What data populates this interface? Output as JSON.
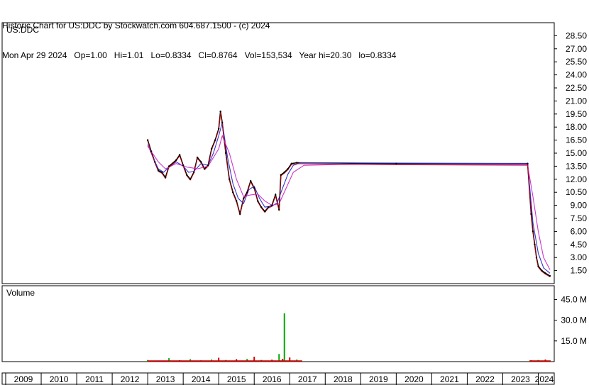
{
  "header": {
    "line1": "Historic Chart for US:DDC by Stockwatch.com 604.687.1500 - (c) 2024",
    "line2": "Mon Apr 29 2024   Op=1.00   Hi=1.01   Lo=0.8334   Cl=0.8764   Vol=153,534   Year hi=20.30   lo=0.8334"
  },
  "colors": {
    "price": "#000000",
    "ma_short": "#cc0000",
    "ma_long": "#3333cc",
    "ma_link": "#cc33cc",
    "volume_up": "#00aa00",
    "volume_down": "#cc0000",
    "grid": "#000000",
    "frame": "#000000"
  },
  "chart_data": [
    {
      "type": "line",
      "panel": "price",
      "title": "US:DDC",
      "ylim": [
        0,
        30
      ],
      "y_ticks": [
        "28.50",
        "27.00",
        "25.50",
        "24.00",
        "22.50",
        "21.00",
        "19.50",
        "18.00",
        "16.50",
        "15.00",
        "13.50",
        "12.00",
        "10.50",
        "9.00",
        "7.50",
        "6.00",
        "4.50",
        "3.00",
        "1.50"
      ],
      "x_ticks": [
        "2009",
        "2010",
        "2011",
        "2012",
        "2013",
        "2014",
        "2015",
        "2016",
        "2017",
        "2018",
        "2019",
        "2020",
        "2021",
        "2022",
        "2023",
        "2024"
      ],
      "series": [
        {
          "values": [
            [
              2013.0,
              16.5
            ],
            [
              2013.1,
              15.2
            ],
            [
              2013.2,
              14.0
            ],
            [
              2013.3,
              13.0
            ],
            [
              2013.4,
              12.8
            ],
            [
              2013.5,
              12.2
            ],
            [
              2013.6,
              13.5
            ],
            [
              2013.8,
              14.2
            ],
            [
              2013.9,
              14.8
            ],
            [
              2014.0,
              13.6
            ],
            [
              2014.1,
              12.5
            ],
            [
              2014.2,
              12.0
            ],
            [
              2014.3,
              12.8
            ],
            [
              2014.4,
              14.5
            ],
            [
              2014.5,
              14.0
            ],
            [
              2014.6,
              13.2
            ],
            [
              2014.7,
              13.6
            ],
            [
              2014.8,
              15.5
            ],
            [
              2014.9,
              16.5
            ],
            [
              2015.0,
              17.8
            ],
            [
              2015.05,
              19.8
            ],
            [
              2015.1,
              18.5
            ],
            [
              2015.2,
              15.0
            ],
            [
              2015.3,
              12.0
            ],
            [
              2015.4,
              10.5
            ],
            [
              2015.5,
              9.5
            ],
            [
              2015.6,
              8.0
            ],
            [
              2015.7,
              9.8
            ],
            [
              2015.8,
              10.5
            ],
            [
              2015.9,
              11.8
            ],
            [
              2016.0,
              11.0
            ],
            [
              2016.1,
              9.5
            ],
            [
              2016.2,
              8.8
            ],
            [
              2016.3,
              8.3
            ],
            [
              2016.4,
              8.8
            ],
            [
              2016.5,
              9.0
            ],
            [
              2016.6,
              10.2
            ],
            [
              2016.7,
              8.5
            ],
            [
              2016.75,
              12.5
            ],
            [
              2016.85,
              12.8
            ],
            [
              2016.95,
              13.2
            ],
            [
              2017.05,
              13.8
            ],
            [
              2017.2,
              13.9
            ],
            [
              2020.0,
              13.8
            ],
            [
              2023.7,
              13.8
            ],
            [
              2023.8,
              8.0
            ],
            [
              2023.85,
              6.0
            ],
            [
              2023.9,
              4.5
            ],
            [
              2023.95,
              3.0
            ],
            [
              2024.0,
              2.0
            ],
            [
              2024.1,
              1.5
            ],
            [
              2024.2,
              1.2
            ],
            [
              2024.33,
              0.88
            ]
          ]
        },
        {
          "values": [
            [
              2013.0,
              16.0
            ],
            [
              2013.15,
              14.5
            ],
            [
              2013.3,
              13.2
            ],
            [
              2013.45,
              12.8
            ],
            [
              2013.6,
              13.4
            ],
            [
              2013.8,
              14.0
            ],
            [
              2014.0,
              13.5
            ],
            [
              2014.15,
              12.8
            ],
            [
              2014.3,
              12.9
            ],
            [
              2014.5,
              13.8
            ],
            [
              2014.7,
              13.6
            ],
            [
              2014.85,
              15.0
            ],
            [
              2015.0,
              17.0
            ],
            [
              2015.1,
              18.5
            ],
            [
              2015.25,
              14.5
            ],
            [
              2015.4,
              11.5
            ],
            [
              2015.55,
              9.8
            ],
            [
              2015.7,
              9.2
            ],
            [
              2015.85,
              10.8
            ],
            [
              2016.0,
              11.2
            ],
            [
              2016.15,
              9.8
            ],
            [
              2016.3,
              8.8
            ],
            [
              2016.5,
              8.9
            ],
            [
              2016.65,
              9.3
            ],
            [
              2016.8,
              11.0
            ],
            [
              2016.95,
              12.6
            ],
            [
              2017.1,
              13.6
            ],
            [
              2017.3,
              13.9
            ],
            [
              2023.7,
              13.8
            ],
            [
              2023.85,
              7.0
            ],
            [
              2024.0,
              3.5
            ],
            [
              2024.15,
              1.8
            ],
            [
              2024.33,
              1.2
            ]
          ]
        },
        {
          "values": [
            [
              2013.0,
              15.8
            ],
            [
              2013.3,
              14.0
            ],
            [
              2013.5,
              13.2
            ],
            [
              2013.8,
              13.8
            ],
            [
              2014.1,
              13.4
            ],
            [
              2014.4,
              13.2
            ],
            [
              2014.7,
              13.5
            ],
            [
              2015.0,
              15.5
            ],
            [
              2015.1,
              17.0
            ],
            [
              2015.3,
              15.0
            ],
            [
              2015.5,
              12.0
            ],
            [
              2015.7,
              10.0
            ],
            [
              2015.9,
              10.2
            ],
            [
              2016.1,
              10.3
            ],
            [
              2016.3,
              9.5
            ],
            [
              2016.5,
              9.0
            ],
            [
              2016.7,
              9.2
            ],
            [
              2016.9,
              11.0
            ],
            [
              2017.1,
              12.8
            ],
            [
              2017.4,
              13.6
            ],
            [
              2018.5,
              13.7
            ],
            [
              2023.7,
              13.6
            ],
            [
              2023.85,
              10.0
            ],
            [
              2024.0,
              6.0
            ],
            [
              2024.15,
              3.0
            ],
            [
              2024.33,
              1.6
            ]
          ]
        }
      ]
    },
    {
      "type": "bar",
      "panel": "volume",
      "title": "Volume",
      "ylim": [
        0,
        55
      ],
      "y_ticks": [
        "45.0 M",
        "30.0 M",
        "15.0 M"
      ],
      "values": [
        [
          2013.0,
          1.2
        ],
        [
          2013.3,
          0.8
        ],
        [
          2013.6,
          2.5
        ],
        [
          2013.9,
          1.0
        ],
        [
          2014.2,
          1.8
        ],
        [
          2014.5,
          0.9
        ],
        [
          2014.8,
          1.5
        ],
        [
          2015.0,
          2.8
        ],
        [
          2015.2,
          1.2
        ],
        [
          2015.5,
          1.8
        ],
        [
          2015.8,
          2.0
        ],
        [
          2016.0,
          3.5
        ],
        [
          2016.2,
          1.2
        ],
        [
          2016.5,
          1.4
        ],
        [
          2016.7,
          5.5
        ],
        [
          2016.8,
          2.0
        ],
        [
          2016.85,
          35.0
        ],
        [
          2017.0,
          3.0
        ],
        [
          2017.2,
          1.5
        ],
        [
          2023.8,
          1.0
        ],
        [
          2024.0,
          1.2
        ],
        [
          2024.2,
          1.5
        ]
      ]
    }
  ]
}
